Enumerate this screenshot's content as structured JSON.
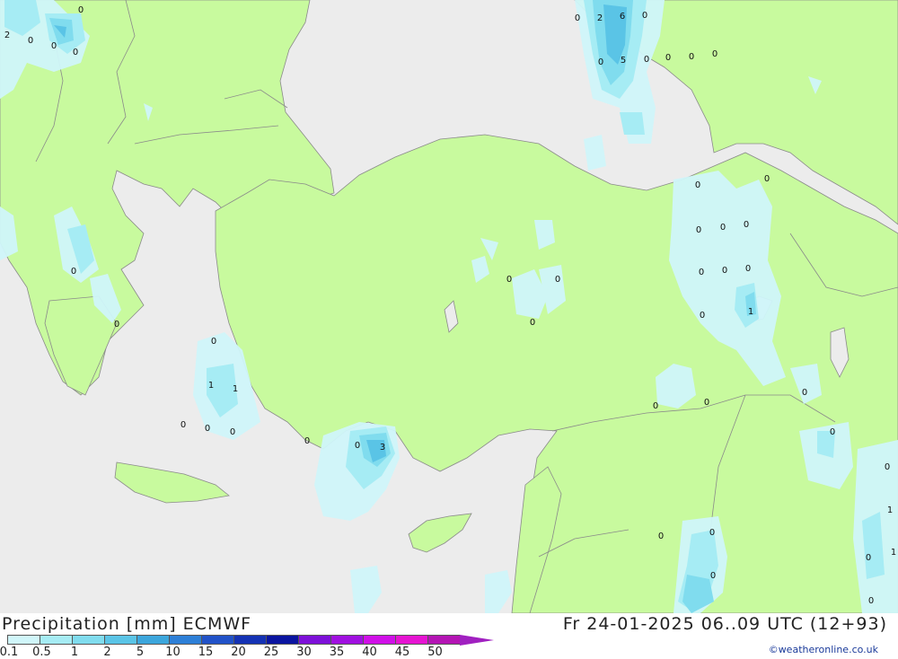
{
  "title": "Precipitation [mm] ECMWF",
  "valid": "Fr 24-01-2025 06..09 UTC (12+93)",
  "credit": "©weatheronline.co.uk",
  "colors": {
    "sea": "#ececec",
    "land": "#c8fa9e",
    "border": "#888888",
    "p01": "#d0f6fa",
    "p05": "#a6ecf4",
    "p1": "#80dcee",
    "p2": "#5ac4e6"
  },
  "legend": {
    "labels": [
      "0.1",
      "0.5",
      "1",
      "2",
      "5",
      "10",
      "15",
      "20",
      "25",
      "30",
      "35",
      "40",
      "45",
      "50"
    ],
    "colors": [
      "#d0f6fa",
      "#a6ecf4",
      "#80dcee",
      "#5ac4e6",
      "#3ca6dc",
      "#2d7fd7",
      "#2152c8",
      "#1432b4",
      "#0a14a0",
      "#7d10d8",
      "#a010e0",
      "#d010e8",
      "#e614d2",
      "#b414b4"
    ]
  },
  "stations": [
    {
      "v": "0"
    },
    {
      "v": "2"
    },
    {
      "v": "0"
    },
    {
      "v": "0"
    },
    {
      "v": "0"
    },
    {
      "v": "0"
    },
    {
      "v": "2"
    },
    {
      "v": "6"
    },
    {
      "v": "0"
    },
    {
      "v": "0"
    },
    {
      "v": "5"
    },
    {
      "v": "0"
    },
    {
      "v": "0"
    },
    {
      "v": "0"
    },
    {
      "v": "0"
    },
    {
      "v": "0"
    },
    {
      "v": "0"
    },
    {
      "v": "0"
    },
    {
      "v": "0"
    },
    {
      "v": "0"
    },
    {
      "v": "0"
    },
    {
      "v": "0"
    },
    {
      "v": "0"
    },
    {
      "v": "1"
    },
    {
      "v": "0"
    },
    {
      "v": "0"
    },
    {
      "v": "0"
    },
    {
      "v": "0"
    },
    {
      "v": "0"
    },
    {
      "v": "0"
    },
    {
      "v": "0"
    },
    {
      "v": "1"
    },
    {
      "v": "1"
    },
    {
      "v": "0"
    },
    {
      "v": "0"
    },
    {
      "v": "0"
    },
    {
      "v": "0"
    },
    {
      "v": "0"
    },
    {
      "v": "3"
    },
    {
      "v": "0"
    },
    {
      "v": "0"
    },
    {
      "v": "0"
    },
    {
      "v": "0"
    },
    {
      "v": "0"
    },
    {
      "v": "0"
    },
    {
      "v": "0"
    },
    {
      "v": "0"
    },
    {
      "v": "1"
    },
    {
      "v": "0"
    },
    {
      "v": "1"
    },
    {
      "v": "0"
    }
  ]
}
